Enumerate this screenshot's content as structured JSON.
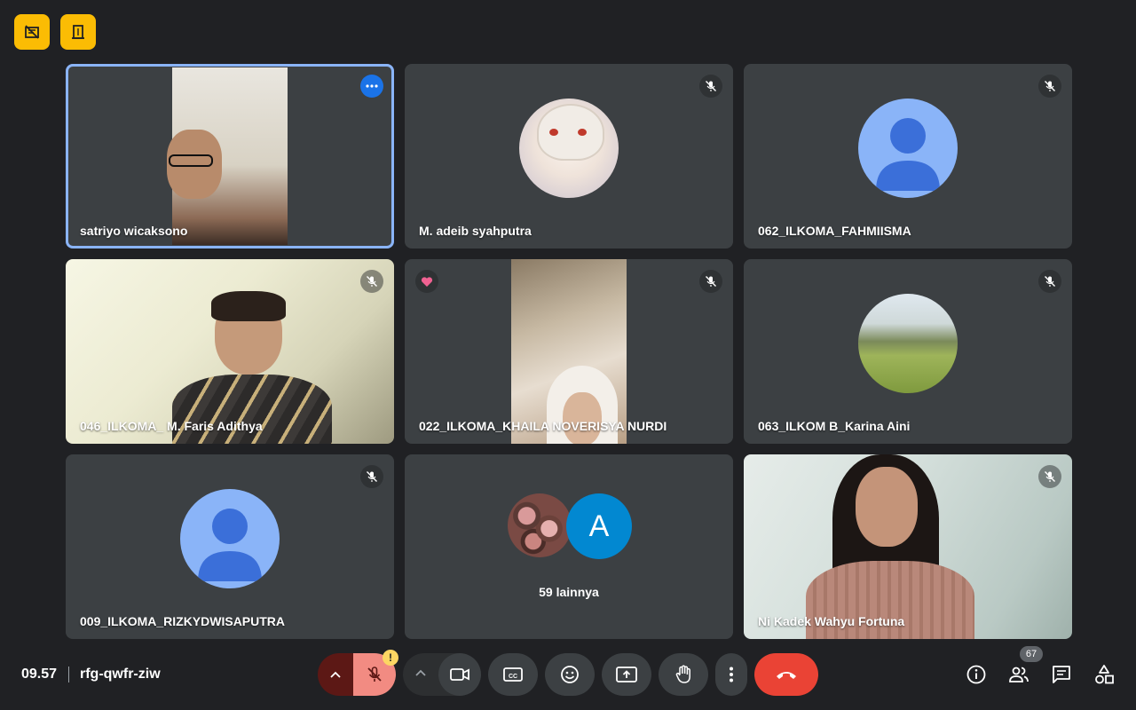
{
  "participants": [
    {
      "name": "satriyo wicaksono"
    },
    {
      "name": "M. adeib syahputra"
    },
    {
      "name": "062_ILKOMA_FAHMIISMA"
    },
    {
      "name": "046_ILKOMA_ M. Faris Adithya"
    },
    {
      "name": "022_ILKOMA_KHAILA NOVERISYA NURDI"
    },
    {
      "name": "063_ILKOM B_Karina Aini"
    },
    {
      "name": "009_ILKOMA_RIZKYDWISAPUTRA"
    },
    {
      "name": "Ni Kadek Wahyu Fortuna"
    }
  ],
  "others_tile": {
    "label": "59 lainnya",
    "avatar_letter": "A"
  },
  "bottom_bar": {
    "time": "09.57",
    "meeting_code": "rfg-qwfr-ziw",
    "warning_mark": "!",
    "people_count": "67"
  },
  "colors": {
    "background": "#202124",
    "tile": "#3c4043",
    "accent_yellow": "#fbbc04",
    "end_call": "#ea4335",
    "mic_muted": "#f28b82"
  }
}
